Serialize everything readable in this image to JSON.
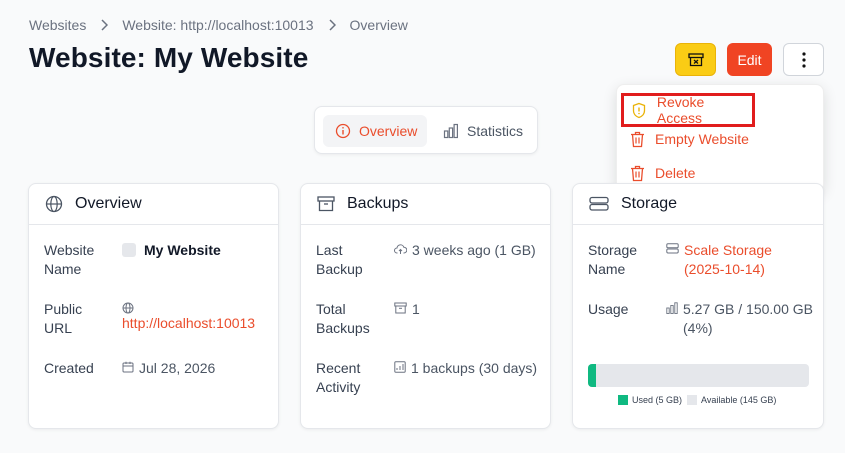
{
  "breadcrumb": [
    "Websites",
    "Website: http://localhost:10013",
    "Overview"
  ],
  "title": "Website: My Website",
  "actions": {
    "edit_label": "Edit"
  },
  "menu": {
    "revoke": "Revoke Access",
    "empty": "Empty Website",
    "delete": "Delete"
  },
  "tabs": {
    "overview": "Overview",
    "statistics": "Statistics"
  },
  "overview_card": {
    "title": "Overview",
    "name_label": "Website Name",
    "name_value": "My Website",
    "url_label": "Public URL",
    "url_value": "http://localhost:10013",
    "created_label": "Created",
    "created_value": "Jul 28, 2026"
  },
  "backups_card": {
    "title": "Backups",
    "last_label": "Last Backup",
    "last_value": "3 weeks ago (1 GB)",
    "total_label": "Total Backups",
    "total_value": "1",
    "recent_label": "Recent Activity",
    "recent_value": "1 backups (30 days)"
  },
  "storage_card": {
    "title": "Storage",
    "name_label": "Storage Name",
    "name_value": "Scale Storage (2025-10-14)",
    "usage_label": "Usage",
    "usage_value": "5.27 GB / 150.00 GB (4%)",
    "used_fraction": 0.035,
    "legend_used": "Used (5 GB)",
    "legend_available": "Available (145 GB)"
  },
  "colors": {
    "accent": "#ea4d2c",
    "used": "#10b981",
    "available": "#e5e7eb",
    "archive": "#facc15"
  }
}
